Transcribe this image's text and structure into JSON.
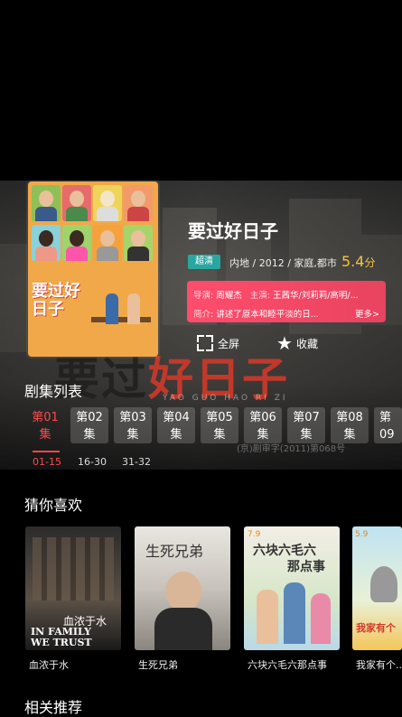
{
  "show": {
    "title": "要过好日子",
    "quality_tag": "超清",
    "meta": "内地 / 2012 / 家庭,都市",
    "rating_main": "5.4",
    "rating_unit": "分",
    "director_label": "导演:",
    "director": "周耀杰",
    "cast_label": "主演:",
    "cast": "王茜华/刘莉莉/高明/...",
    "synopsis_label": "简介:",
    "synopsis": "讲述了原本和睦平淡的日...",
    "more_label": "更多>",
    "poster_title_art": "要过好日子",
    "background_title_art_a": "要过",
    "background_title_art_b": "好日子",
    "background_pinyin": "YAO GUO HAO RI ZI",
    "background_license": "(京)剧审字(2011)第068号"
  },
  "actions": {
    "fullscreen_label": "全屏",
    "favorite_label": "收藏"
  },
  "episodes": {
    "section_title": "剧集列表",
    "items": [
      {
        "num": "第01",
        "unit": "集"
      },
      {
        "num": "第02",
        "unit": "集"
      },
      {
        "num": "第03",
        "unit": "集"
      },
      {
        "num": "第04",
        "unit": "集"
      },
      {
        "num": "第05",
        "unit": "集"
      },
      {
        "num": "第06",
        "unit": "集"
      },
      {
        "num": "第07",
        "unit": "集"
      },
      {
        "num": "第08",
        "unit": "集"
      },
      {
        "num": "第09",
        "unit": "集"
      }
    ],
    "ranges": [
      "01-15",
      "16-30",
      "31-32"
    ],
    "active_index": 0
  },
  "guess": {
    "section_title": "猜你喜欢",
    "items": [
      {
        "label": "血浓于水",
        "poster_text_a": "血浓于水",
        "poster_text_b": "IN FAMILY",
        "poster_text_c": "WE TRUST"
      },
      {
        "label": "生死兄弟",
        "poster_text_a": "生死兄弟",
        "poster_text_b": "",
        "poster_text_c": ""
      },
      {
        "label": "六块六毛六那点事",
        "poster_text_a": "六块六毛六",
        "poster_text_b": "那点事",
        "poster_text_c": "7.9"
      },
      {
        "label": "我家有个...",
        "poster_text_a": "我家有个",
        "poster_text_b": "",
        "poster_text_c": "5.9"
      }
    ]
  },
  "related": {
    "section_title": "相关推荐"
  },
  "colors": {
    "accent_red": "#ff4a4a",
    "info_pink": "#ff4d6d",
    "rating_gold": "#f5c443",
    "tag_teal": "#2aa6a0"
  }
}
